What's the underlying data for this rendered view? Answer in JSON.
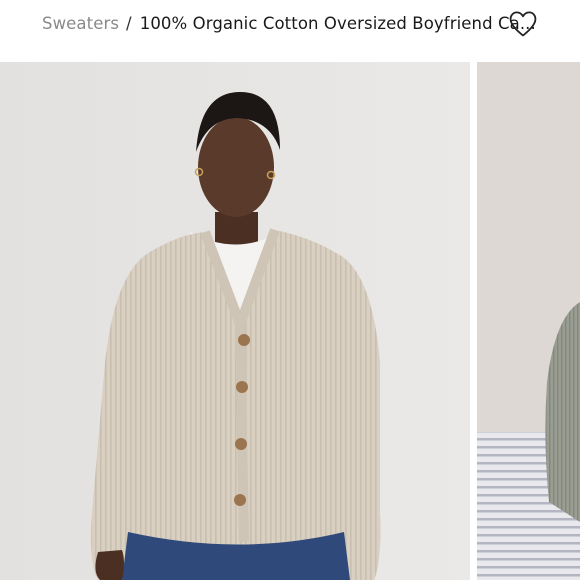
{
  "breadcrumb": {
    "parent_label": "Sweaters",
    "separator": "/",
    "current_label": "100% Organic Cotton Oversized Boyfriend Ca..."
  },
  "favorite": {
    "icon": "heart-outline-icon"
  },
  "gallery": {
    "images": [
      {
        "subject": "model wearing oatmeal ribbed oversized cardigan over white tee with blue jeans",
        "active": true
      },
      {
        "subject": "grey cardigan draped on striped bedding",
        "active": false
      }
    ]
  },
  "colors": {
    "background": "#ffffff",
    "breadcrumb_parent": "#8a8a8a",
    "breadcrumb_current": "#1a1a1a",
    "cardigan": "#d8cfc1",
    "photo_backdrop": "#e6e4e2"
  }
}
